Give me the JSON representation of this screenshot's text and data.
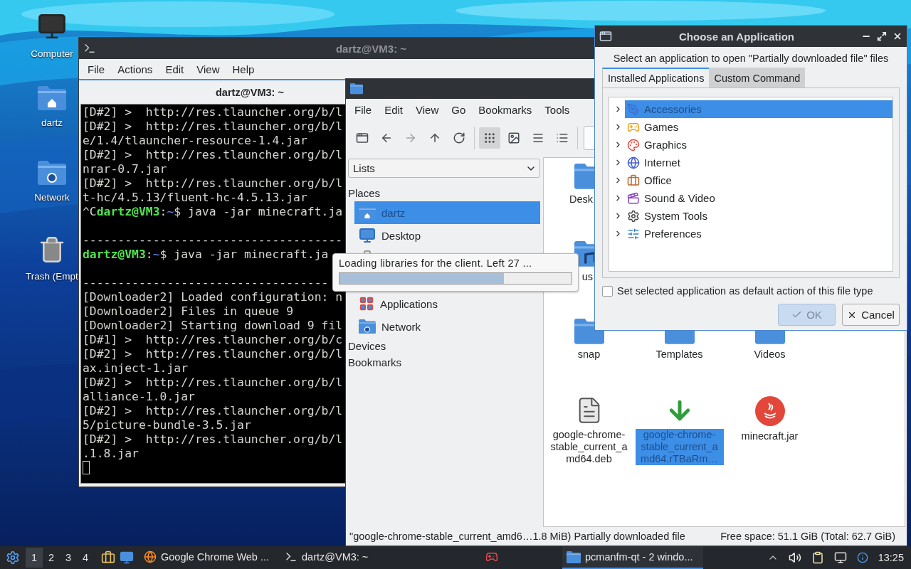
{
  "desktop_icons": [
    {
      "label": "Computer",
      "kind": "computer"
    },
    {
      "label": "dartz",
      "kind": "home"
    },
    {
      "label": "Network",
      "kind": "network"
    },
    {
      "label": "Trash (Empt",
      "kind": "trash"
    }
  ],
  "terminal": {
    "title": "dartz@VM3: ~",
    "menu": [
      "File",
      "Actions",
      "Edit",
      "View",
      "Help"
    ],
    "tab": "dartz@VM3: ~",
    "lines": [
      {
        "kind": "text",
        "text": "[D#2] >  http://res.tlauncher.org/b/l"
      },
      {
        "kind": "text",
        "text": "[D#2] >  http://res.tlauncher.org/b/l"
      },
      {
        "kind": "text",
        "text": "e/1.4/tlauncher-resource-1.4.jar"
      },
      {
        "kind": "text",
        "text": "[D#2] >  http://res.tlauncher.org/b/l"
      },
      {
        "kind": "text",
        "text": "nrar-0.7.jar"
      },
      {
        "kind": "text",
        "text": "[D#2] >  http://res.tlauncher.org/b/l"
      },
      {
        "kind": "text",
        "text": "t-hc/4.5.13/fluent-hc-4.5.13.jar"
      },
      {
        "kind": "prompt",
        "segments": [
          {
            "text": "^C",
            "kind": "plain"
          },
          {
            "text": "dartz@VM3",
            "kind": "user"
          },
          {
            "text": ":",
            "kind": "plain"
          },
          {
            "text": "~",
            "kind": "path"
          },
          {
            "text": "$ java -jar minecraft.ja",
            "kind": "plain"
          }
        ]
      },
      {
        "kind": "blank"
      },
      {
        "kind": "text",
        "text": "-------------------------------------"
      },
      {
        "kind": "prompt",
        "segments": [
          {
            "text": "dartz@VM3",
            "kind": "user"
          },
          {
            "text": ":",
            "kind": "plain"
          },
          {
            "text": "~",
            "kind": "path"
          },
          {
            "text": "$ java -jar minecraft.ja",
            "kind": "plain"
          }
        ]
      },
      {
        "kind": "blank"
      },
      {
        "kind": "text",
        "text": "-----------------------------------"
      },
      {
        "kind": "text",
        "text": "[Downloader2] Loaded configuration: n"
      },
      {
        "kind": "text",
        "text": "[Downloader2] Files in queue 9"
      },
      {
        "kind": "text",
        "text": "[Downloader2] Starting download 9 fil"
      },
      {
        "kind": "text",
        "text": "[D#1] >  http://res.tlauncher.org/b/c"
      },
      {
        "kind": "text",
        "text": "[D#2] >  http://res.tlauncher.org/b/l"
      },
      {
        "kind": "text",
        "text": "ax.inject-1.jar"
      },
      {
        "kind": "text",
        "text": "[D#2] >  http://res.tlauncher.org/b/l"
      },
      {
        "kind": "text",
        "text": "alliance-1.0.jar"
      },
      {
        "kind": "text",
        "text": "[D#2] >  http://res.tlauncher.org/b/l"
      },
      {
        "kind": "text",
        "text": "5/picture-bundle-3.5.jar"
      },
      {
        "kind": "text",
        "text": "[D#2] >  http://res.tlauncher.org/b/l"
      },
      {
        "kind": "text",
        "text": ".1.8.jar"
      },
      {
        "kind": "cursor"
      }
    ]
  },
  "loading": {
    "text": "Loading libraries for the client. Left 27 ...",
    "level": 0.71
  },
  "file_manager": {
    "menu": [
      "File",
      "Edit",
      "View",
      "Go",
      "Bookmarks",
      "Tools"
    ],
    "nav": [
      {
        "kind": "new-window",
        "disabled": false
      },
      {
        "kind": "back",
        "disabled": false
      },
      {
        "kind": "forward",
        "disabled": true
      },
      {
        "kind": "up",
        "disabled": false
      },
      {
        "kind": "reload",
        "disabled": false
      }
    ],
    "views": [
      {
        "kind": "icons",
        "selected": true
      },
      {
        "kind": "thumbnails",
        "selected": false
      },
      {
        "kind": "compact",
        "selected": false
      },
      {
        "kind": "details",
        "selected": false
      }
    ],
    "side_mode": "Lists",
    "sections": [
      {
        "title": "Places",
        "items": [
          {
            "label": "dartz",
            "kind": "home",
            "selected": true
          },
          {
            "label": "Desktop",
            "kind": "desktop",
            "selected": false
          },
          {
            "kind": "trash",
            "selected": false
          },
          {
            "label": "Applications",
            "kind": "apps",
            "selected": false
          },
          {
            "label": "Network",
            "kind": "network",
            "selected": false
          }
        ]
      },
      {
        "title": "Devices"
      },
      {
        "title": "Bookmarks"
      }
    ],
    "file_rows": [
      [
        {
          "label": "Desk",
          "kind": "folder",
          "clipped": true,
          "selected": false
        }
      ],
      [
        {
          "label": "us",
          "kind": "music",
          "clipped": true,
          "selected": false
        }
      ],
      [
        {
          "label": "snap",
          "kind": "folder",
          "clipped": false,
          "selected": false
        },
        {
          "label": "Templates",
          "kind": "folder",
          "clipped": false,
          "selected": false
        },
        {
          "label": "Videos",
          "kind": "folder",
          "clipped": false,
          "selected": false
        }
      ],
      [
        {
          "label": "google-chrome-stable_current_amd64.deb",
          "kind": "document",
          "clipped": false,
          "selected": false
        },
        {
          "label": "google-chrome-stable_current_amd64.rTBaRm…",
          "kind": "download",
          "clipped": false,
          "selected": true
        },
        {
          "label": "minecraft.jar",
          "kind": "java",
          "clipped": false,
          "selected": false
        }
      ]
    ],
    "status_left": "\"google-chrome-stable_current_amd6…1.8 MiB) Partially downloaded file",
    "status_right": "Free space: 51.1 GiB (Total: 62.7 GiB)"
  },
  "dialog": {
    "title": "Choose an Application",
    "prompt": "Select an application to open \"Partially downloaded file\" files",
    "tabs": [
      {
        "label": "Installed Applications",
        "selected": true
      },
      {
        "label": "Custom Command",
        "selected": false
      }
    ],
    "categories": [
      {
        "label": "Accessories",
        "kind": "accessories",
        "selected": true,
        "expanded": false
      },
      {
        "label": "Games",
        "kind": "games",
        "selected": false,
        "expanded": false
      },
      {
        "label": "Graphics",
        "kind": "graphics",
        "selected": false,
        "expanded": false
      },
      {
        "label": "Internet",
        "kind": "internet",
        "selected": false,
        "expanded": false
      },
      {
        "label": "Office",
        "kind": "office",
        "selected": false,
        "expanded": false
      },
      {
        "label": "Sound & Video",
        "kind": "media",
        "selected": false,
        "expanded": false
      },
      {
        "label": "System Tools",
        "kind": "system",
        "selected": false,
        "expanded": false
      },
      {
        "label": "Preferences",
        "kind": "preferences",
        "selected": false,
        "expanded": false
      }
    ],
    "default_option": {
      "label": "Set selected application as default action of this file type",
      "checked": false
    },
    "buttons": [
      {
        "label": "OK",
        "kind": "ok",
        "disabled": true
      },
      {
        "label": "Cancel",
        "kind": "cancel",
        "disabled": false
      }
    ]
  },
  "taskbar": {
    "workspaces": [
      {
        "label": "1",
        "selected": true
      },
      {
        "label": "2",
        "selected": false
      },
      {
        "label": "3",
        "selected": false
      },
      {
        "label": "4",
        "selected": false
      }
    ],
    "tasks": [
      {
        "label": "Google Chrome Web ...",
        "kind": "browser",
        "selected": false
      },
      {
        "label": "dartz@VM3: ~",
        "kind": "terminal",
        "selected": false
      },
      {
        "kind": "game",
        "selected": false
      },
      {
        "label": "pcmanfm-qt - 2 windo...",
        "kind": "files",
        "selected": true
      }
    ],
    "clock": "13:25"
  }
}
